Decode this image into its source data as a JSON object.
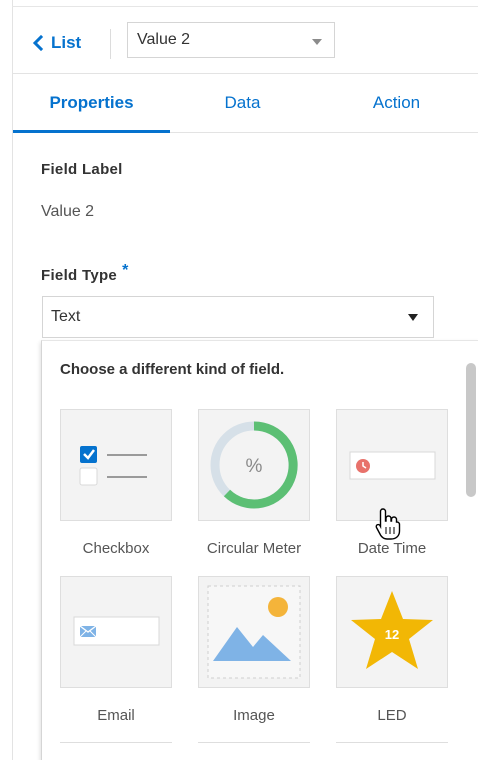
{
  "header": {
    "back_label": "List",
    "selected_value": "Value 2"
  },
  "tabs": [
    {
      "label": "Properties",
      "active": true
    },
    {
      "label": "Data",
      "active": false
    },
    {
      "label": "Action",
      "active": false
    }
  ],
  "properties": {
    "field_label_title": "Field Label",
    "field_label_value": "Value 2",
    "field_type_title": "Field Type",
    "required_marker": "*",
    "field_type_value": "Text"
  },
  "panel": {
    "title": "Choose a different kind of field.",
    "tiles": [
      {
        "label": "Checkbox",
        "icon": "checkbox-icon"
      },
      {
        "label": "Circular Meter",
        "icon": "circular-meter-icon",
        "icon_text": "%"
      },
      {
        "label": "Date Time",
        "icon": "date-time-icon"
      },
      {
        "label": "Email",
        "icon": "email-icon"
      },
      {
        "label": "Image",
        "icon": "image-icon"
      },
      {
        "label": "LED",
        "icon": "led-icon",
        "icon_text": "12"
      }
    ]
  },
  "colors": {
    "accent": "#0572ce",
    "meter_green": "#5cbf74",
    "meter_track": "#d6e0e8",
    "star": "#f2b705",
    "image_blue": "#7fb3e6",
    "image_sun": "#f4b43a",
    "clock_red": "#e8726b"
  }
}
